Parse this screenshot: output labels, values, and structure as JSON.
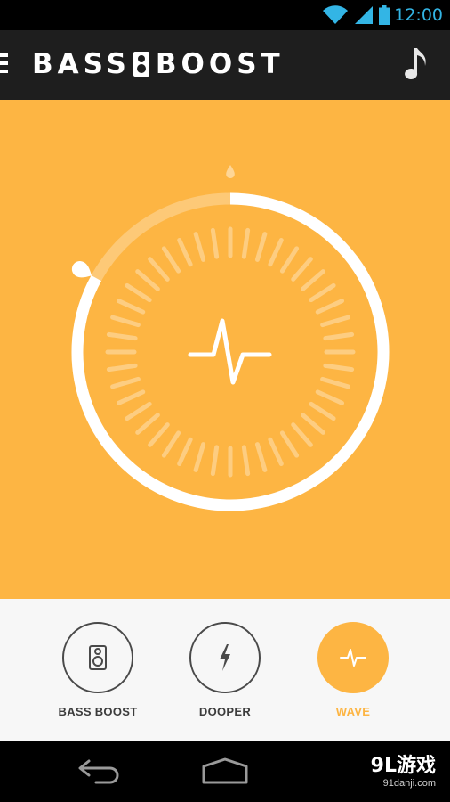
{
  "status_bar": {
    "time": "12:00",
    "icons": [
      "wifi-icon",
      "signal-icon",
      "battery-icon"
    ],
    "accent_color": "#33b5e5"
  },
  "app_bar": {
    "title_left": "BASS",
    "title_right": "BOOST",
    "menu_icon": "menu-icon",
    "action_icon": "music-note-icon"
  },
  "dial": {
    "center_icon": "pulse-wave-icon",
    "level_fraction": 0.83,
    "background_color": "#fdb543"
  },
  "modes": [
    {
      "label": "BASS BOOST",
      "icon": "speaker-icon",
      "active": false
    },
    {
      "label": "DOOPER",
      "icon": "lightning-icon",
      "active": false
    },
    {
      "label": "WAVE",
      "icon": "pulse-wave-icon",
      "active": true
    }
  ],
  "nav_bar": {
    "buttons": [
      "back-button",
      "home-button"
    ]
  },
  "watermark": {
    "brand": "9L游戏",
    "site": "91danji.com"
  }
}
